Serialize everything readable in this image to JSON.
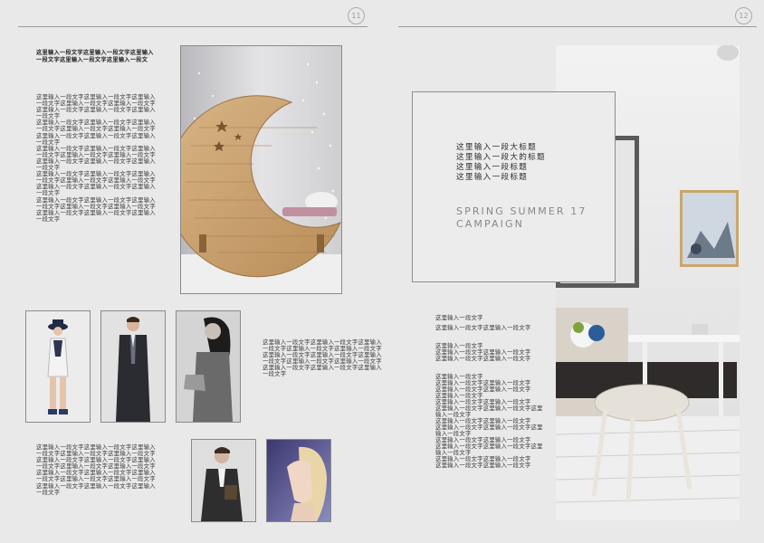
{
  "pages": {
    "left_number": "11",
    "right_number": "12"
  },
  "left": {
    "intro_bold": "这里输入一段文字这里输入一段文字这里输入\n一段文字这里输入一段文字这里输入一段文",
    "body1": "这里输入一段文字这里输入一段文字这里输入\n一段文字这里输入一段文字这里输入一段文字\n这里输入一段文字这里输入一段文字这里输入\n一段文字\n这里输入一段文字这里输入一段文字这里输入\n一段文字这里输入一段文字这里输入一段文字\n这里输入一段文字这里输入一段文字这里输入\n一段文字\n这里输入一段文字这里输入一段文字这里输入\n一段文字这里输入一段文字这里输入一段文字\n这里输入一段文字这里输入一段文字这里输入\n一段文字\n这里输入一段文字这里输入一段文字这里输入\n一段文字这里输入一段文字这里输入一段文字\n这里输入一段文字这里输入一段文字这里输入\n一段文字\n这里输入一段文字这里输入一段文字这里输入\n一段文字这里输入一段文字这里输入一段文字\n这里输入一段文字这里输入一段文字这里输入\n一段文字",
    "body2": "这里输入一段文字这里输入一段文字这里输入\n一段文字这里输入一段文字这里输入一段文字\n这里输入一段文字这里输入一段文字这里输入\n一段文字这里输入一段文字这里输入一段文字\n这里输入一段文字这里输入一段文字这里输入\n一段文字",
    "body3": "这里输入一段文字这里输入一段文字这里输入\n一段文字这里输入一段文字这里输入一段文字\n这里输入一段文字这里输入一段文字这里输入\n一段文字这里输入一段文字这里输入一段文字\n这里输入一段文字这里输入一段文字这里输入\n一段文字这里输入一段文字这里输入一段文字\n这里输入一段文字这里输入一段文字这里输入\n一段文字"
  },
  "right": {
    "headings": "这里输入一段大标题\n这里输入一段大的标题\n这里输入一段标题\n这里输入一段标题",
    "campaign": "SPRING SUMMER 17\nCAMPAIGN",
    "text_a": "这里输入一段文字",
    "text_b": "这里输入一段文字这里输入一段文字",
    "text_c": "这里输入一段文字\n这里输入一段文字这里输入一段文字\n这里输入一段文字这里输入一段文字",
    "text_d": "这里输入一段文字\n这里输入一段文字这里输入一段文字\n这里输入一段文字这里输入一段文字\n这里输入一段文字\n这里输入一段文字这里输入一段文字\n这里输入一段文字这里输入一段文字这里\n输入一段文字\n这里输入一段文字这里输入一段文字\n这里输入一段文字这里输入一段文字这里\n输入一段文字\n这里输入一段文字这里输入一段文字\n这里输入一段文字这里输入一段文字这里\n输入一段文字\n这里输入一段文字这里输入一段文字\n这里输入一段文字这里输入一段文字"
  }
}
